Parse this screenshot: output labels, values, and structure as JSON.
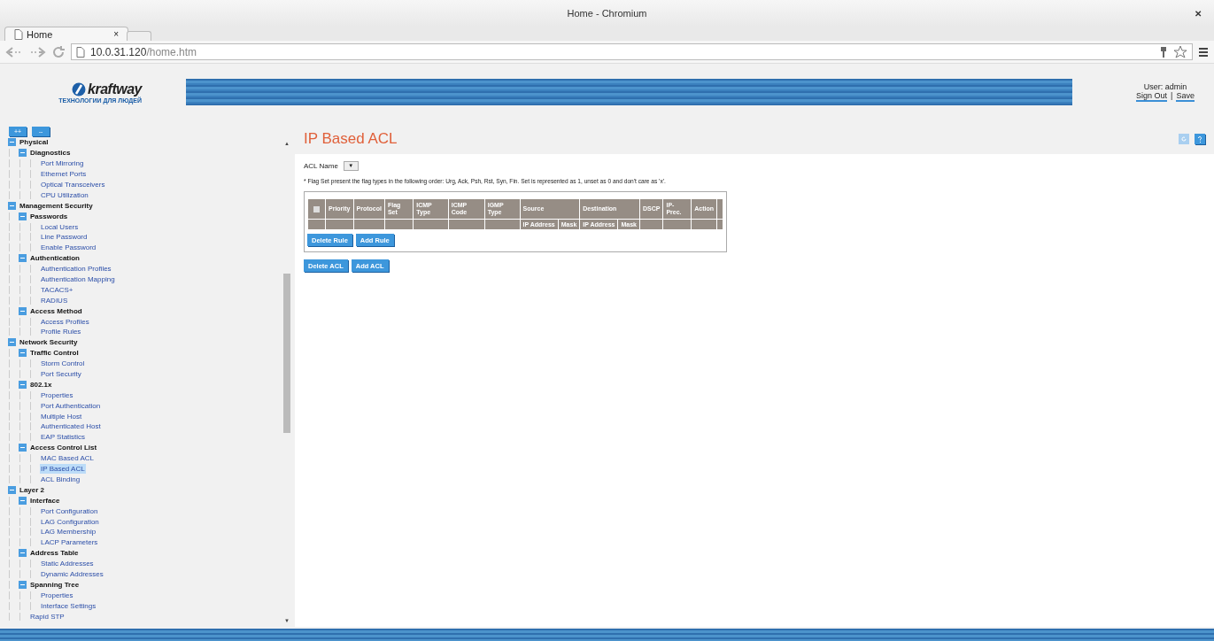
{
  "window": {
    "title": "Home - Chromium"
  },
  "tab": {
    "title": "Home"
  },
  "address_bar": {
    "host": "10.0.31.120",
    "path": "/home.htm"
  },
  "browser_glyphs": {
    "window_close": "✕",
    "tab_close": "×",
    "scroll_up": "▲",
    "scroll_down": "▼",
    "dropdown": "▼"
  },
  "header": {
    "tagline": "ТЕХНОЛОГИИ ДЛЯ ЛЮДЕЙ",
    "brand": "kraftway",
    "user": "User: admin",
    "links": [
      "Sign Out",
      "Save"
    ],
    "separator": "|"
  },
  "sidebar": {
    "buttons": [
      "++",
      "--"
    ],
    "tree": [
      {
        "label": "Physical",
        "kind": "group",
        "expanded": true,
        "children": [
          {
            "label": "Diagnostics",
            "kind": "group",
            "expanded": true,
            "children": [
              {
                "label": "Port Mirroring",
                "kind": "leaf",
                "selected": false
              },
              {
                "label": "Ethernet Ports",
                "kind": "leaf",
                "selected": false
              },
              {
                "label": "Optical Transceivers",
                "kind": "leaf",
                "selected": false
              },
              {
                "label": "CPU Utilization",
                "kind": "leaf",
                "selected": false
              }
            ]
          }
        ]
      },
      {
        "label": "Management Security",
        "kind": "group",
        "expanded": true,
        "children": [
          {
            "label": "Passwords",
            "kind": "group",
            "expanded": true,
            "children": [
              {
                "label": "Local Users",
                "kind": "leaf",
                "selected": false
              },
              {
                "label": "Line Password",
                "kind": "leaf",
                "selected": false
              },
              {
                "label": "Enable Password",
                "kind": "leaf",
                "selected": false
              }
            ]
          },
          {
            "label": "Authentication",
            "kind": "group",
            "expanded": true,
            "children": [
              {
                "label": "Authentication Profiles",
                "kind": "leaf",
                "selected": false
              },
              {
                "label": "Authentication Mapping",
                "kind": "leaf",
                "selected": false
              },
              {
                "label": "TACACS+",
                "kind": "leaf",
                "selected": false
              },
              {
                "label": "RADIUS",
                "kind": "leaf",
                "selected": false
              }
            ]
          },
          {
            "label": "Access Method",
            "kind": "group",
            "expanded": true,
            "children": [
              {
                "label": "Access Profiles",
                "kind": "leaf",
                "selected": false
              },
              {
                "label": "Profile Rules",
                "kind": "leaf",
                "selected": false
              }
            ]
          }
        ]
      },
      {
        "label": "Network Security",
        "kind": "group",
        "expanded": true,
        "children": [
          {
            "label": "Traffic Control",
            "kind": "group",
            "expanded": true,
            "children": [
              {
                "label": "Storm Control",
                "kind": "leaf",
                "selected": false
              },
              {
                "label": "Port Security",
                "kind": "leaf",
                "selected": false
              }
            ]
          },
          {
            "label": "802.1x",
            "kind": "group",
            "expanded": true,
            "children": [
              {
                "label": "Properties",
                "kind": "leaf",
                "selected": false
              },
              {
                "label": "Port Authentication",
                "kind": "leaf",
                "selected": false
              },
              {
                "label": "Multiple Host",
                "kind": "leaf",
                "selected": false
              },
              {
                "label": "Authenticated Host",
                "kind": "leaf",
                "selected": false
              },
              {
                "label": "EAP Statistics",
                "kind": "leaf",
                "selected": false
              }
            ]
          },
          {
            "label": "Access Control List",
            "kind": "group",
            "expanded": true,
            "children": [
              {
                "label": "MAC Based ACL",
                "kind": "leaf",
                "selected": false
              },
              {
                "label": "IP Based ACL",
                "kind": "leaf",
                "selected": true
              },
              {
                "label": "ACL Binding",
                "kind": "leaf",
                "selected": false
              }
            ]
          }
        ]
      },
      {
        "label": "Layer 2",
        "kind": "group",
        "expanded": true,
        "children": [
          {
            "label": "Interface",
            "kind": "group",
            "expanded": true,
            "children": [
              {
                "label": "Port Configuration",
                "kind": "leaf",
                "selected": false
              },
              {
                "label": "LAG Configuration",
                "kind": "leaf",
                "selected": false
              },
              {
                "label": "LAG Membership",
                "kind": "leaf",
                "selected": false
              },
              {
                "label": "LACP Parameters",
                "kind": "leaf",
                "selected": false
              }
            ]
          },
          {
            "label": "Address Table",
            "kind": "group",
            "expanded": true,
            "children": [
              {
                "label": "Static Addresses",
                "kind": "leaf",
                "selected": false
              },
              {
                "label": "Dynamic Addresses",
                "kind": "leaf",
                "selected": false
              }
            ]
          },
          {
            "label": "Spanning Tree",
            "kind": "group",
            "expanded": true,
            "children": [
              {
                "label": "Properties",
                "kind": "leaf",
                "selected": false
              },
              {
                "label": "Interface Settings",
                "kind": "leaf",
                "selected": false
              }
            ]
          },
          {
            "label": "Rapid STP",
            "kind": "leaf",
            "selected": false
          }
        ]
      }
    ]
  },
  "content": {
    "title": "IP Based ACL",
    "acl_name_label": "ACL Name",
    "note": "* Flag Set present the flag types in the following order: Urg, Ack, Psh, Rst, Syn, Fin. Set is represented as 1, unset as 0 and don't care as 'x'.",
    "table": {
      "select_all": {
        "checked": false
      },
      "columns": [
        {
          "label": "Priority"
        },
        {
          "label": "Protocol"
        },
        {
          "label": "Flag Set"
        },
        {
          "label": "ICMP Type"
        },
        {
          "label": "ICMP Code"
        },
        {
          "label": "IGMP Type"
        },
        {
          "label": "Source",
          "subcolumns": [
            "IP Address",
            "Mask"
          ]
        },
        {
          "label": "Destination",
          "subcolumns": [
            "IP Address",
            "Mask"
          ]
        },
        {
          "label": "DSCP"
        },
        {
          "label": "IP-Prec."
        },
        {
          "label": "Action"
        }
      ]
    },
    "rule_buttons": [
      "Delete Rule",
      "Add Rule"
    ],
    "acl_buttons": [
      "Delete ACL",
      "Add ACL"
    ]
  }
}
